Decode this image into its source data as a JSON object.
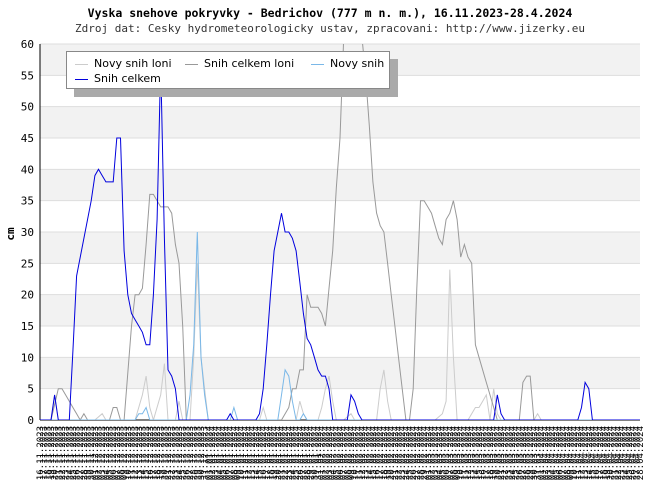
{
  "title": "Vyska snehove pokryvky - Bedrichov (777 m n. m.), 16.11.2023-28.4.2024",
  "subtitle": "Zdroj dat: Cesky hydrometeorologicky ustav, zpracovani: http://www.jizerky.eu",
  "corner_label": "jizerky.eu",
  "chart_data": {
    "type": "line",
    "ylabel": "cm",
    "ylim": [
      0,
      60
    ],
    "yticks": [
      0,
      5,
      10,
      15,
      20,
      25,
      30,
      35,
      40,
      45,
      50,
      55,
      60
    ],
    "xlim": [
      0,
      164
    ],
    "grid": true,
    "legend_position": "top-left",
    "x_start_date": "2023-11-16",
    "x_end_date": "2024-04-28",
    "series": [
      {
        "name": "Novy snih loni",
        "color": "#cccccc",
        "points": [
          [
            0,
            0
          ],
          [
            3,
            0
          ],
          [
            4,
            4
          ],
          [
            5,
            0
          ],
          [
            15,
            0
          ],
          [
            17,
            1
          ],
          [
            18,
            0
          ],
          [
            26,
            0
          ],
          [
            28,
            4
          ],
          [
            29,
            7
          ],
          [
            30,
            2
          ],
          [
            31,
            0
          ],
          [
            33,
            4
          ],
          [
            34,
            9
          ],
          [
            35,
            0
          ],
          [
            37,
            0
          ],
          [
            38,
            3
          ],
          [
            39,
            0
          ],
          [
            41,
            0
          ],
          [
            42,
            10
          ],
          [
            43,
            25
          ],
          [
            44,
            10
          ],
          [
            45,
            5
          ],
          [
            46,
            0
          ],
          [
            60,
            0
          ],
          [
            61,
            2
          ],
          [
            62,
            0
          ],
          [
            70,
            0
          ],
          [
            71,
            3
          ],
          [
            72,
            1
          ],
          [
            73,
            0
          ],
          [
            76,
            0
          ],
          [
            77,
            2
          ],
          [
            78,
            5
          ],
          [
            79,
            7
          ],
          [
            80,
            3
          ],
          [
            81,
            0
          ],
          [
            83,
            0
          ],
          [
            85,
            1
          ],
          [
            86,
            0
          ],
          [
            92,
            0
          ],
          [
            93,
            5
          ],
          [
            94,
            8
          ],
          [
            95,
            3
          ],
          [
            96,
            0
          ],
          [
            108,
            0
          ],
          [
            110,
            1
          ],
          [
            111,
            3
          ],
          [
            112,
            24
          ],
          [
            113,
            10
          ],
          [
            114,
            0
          ],
          [
            117,
            0
          ],
          [
            118,
            1
          ],
          [
            119,
            2
          ],
          [
            120,
            2
          ],
          [
            121,
            3
          ],
          [
            122,
            4
          ],
          [
            123,
            0
          ],
          [
            124,
            5
          ],
          [
            125,
            1
          ],
          [
            126,
            0
          ],
          [
            135,
            0
          ],
          [
            136,
            1
          ],
          [
            137,
            0
          ],
          [
            164,
            0
          ]
        ]
      },
      {
        "name": "Snih celkem loni",
        "color": "#999999",
        "points": [
          [
            0,
            0
          ],
          [
            3,
            0
          ],
          [
            5,
            5
          ],
          [
            6,
            5
          ],
          [
            7,
            4
          ],
          [
            8,
            3
          ],
          [
            9,
            2
          ],
          [
            10,
            1
          ],
          [
            11,
            0
          ],
          [
            12,
            1
          ],
          [
            13,
            0
          ],
          [
            19,
            0
          ],
          [
            20,
            2
          ],
          [
            21,
            2
          ],
          [
            22,
            0
          ],
          [
            23,
            0
          ],
          [
            25,
            15
          ],
          [
            26,
            20
          ],
          [
            27,
            20
          ],
          [
            28,
            21
          ],
          [
            29,
            28
          ],
          [
            30,
            36
          ],
          [
            31,
            36
          ],
          [
            32,
            35
          ],
          [
            33,
            34
          ],
          [
            34,
            34
          ],
          [
            35,
            34
          ],
          [
            36,
            33
          ],
          [
            37,
            28
          ],
          [
            38,
            25
          ],
          [
            39,
            15
          ],
          [
            40,
            0
          ],
          [
            66,
            0
          ],
          [
            68,
            2
          ],
          [
            69,
            5
          ],
          [
            70,
            5
          ],
          [
            71,
            8
          ],
          [
            72,
            8
          ],
          [
            73,
            20
          ],
          [
            74,
            18
          ],
          [
            75,
            18
          ],
          [
            76,
            18
          ],
          [
            77,
            17
          ],
          [
            78,
            15
          ],
          [
            79,
            21
          ],
          [
            80,
            27
          ],
          [
            81,
            37
          ],
          [
            82,
            45
          ],
          [
            83,
            61
          ],
          [
            88,
            61
          ],
          [
            89,
            55
          ],
          [
            90,
            47
          ],
          [
            91,
            38
          ],
          [
            92,
            33
          ],
          [
            93,
            31
          ],
          [
            94,
            30
          ],
          [
            95,
            25
          ],
          [
            96,
            20
          ],
          [
            97,
            15
          ],
          [
            98,
            10
          ],
          [
            99,
            5
          ],
          [
            100,
            0
          ],
          [
            101,
            0
          ],
          [
            102,
            5
          ],
          [
            103,
            21
          ],
          [
            104,
            35
          ],
          [
            105,
            35
          ],
          [
            106,
            34
          ],
          [
            107,
            33
          ],
          [
            108,
            31
          ],
          [
            109,
            29
          ],
          [
            110,
            28
          ],
          [
            111,
            32
          ],
          [
            112,
            33
          ],
          [
            113,
            35
          ],
          [
            114,
            32
          ],
          [
            115,
            26
          ],
          [
            116,
            28
          ],
          [
            117,
            26
          ],
          [
            118,
            25
          ],
          [
            119,
            12
          ],
          [
            120,
            10
          ],
          [
            122,
            6
          ],
          [
            124,
            2
          ],
          [
            125,
            0
          ],
          [
            131,
            0
          ],
          [
            132,
            6
          ],
          [
            133,
            7
          ],
          [
            134,
            7
          ],
          [
            135,
            0
          ],
          [
            164,
            0
          ]
        ]
      },
      {
        "name": "Novy snih",
        "color": "#7ab8e8",
        "points": [
          [
            0,
            0
          ],
          [
            26,
            0
          ],
          [
            27,
            1
          ],
          [
            28,
            1
          ],
          [
            29,
            2
          ],
          [
            30,
            0
          ],
          [
            40,
            0
          ],
          [
            41,
            4
          ],
          [
            42,
            12
          ],
          [
            43,
            30
          ],
          [
            44,
            10
          ],
          [
            45,
            4
          ],
          [
            46,
            0
          ],
          [
            52,
            0
          ],
          [
            53,
            2
          ],
          [
            54,
            0
          ],
          [
            65,
            0
          ],
          [
            66,
            4
          ],
          [
            67,
            8
          ],
          [
            68,
            7
          ],
          [
            69,
            3
          ],
          [
            70,
            0
          ],
          [
            71,
            0
          ],
          [
            72,
            1
          ],
          [
            73,
            0
          ],
          [
            164,
            0
          ]
        ]
      },
      {
        "name": "Snih celkem",
        "color": "#0000dd",
        "points": [
          [
            0,
            0
          ],
          [
            3,
            0
          ],
          [
            4,
            4
          ],
          [
            5,
            0
          ],
          [
            8,
            0
          ],
          [
            9,
            11
          ],
          [
            10,
            23
          ],
          [
            14,
            35
          ],
          [
            15,
            39
          ],
          [
            16,
            40
          ],
          [
            17,
            39
          ],
          [
            18,
            38
          ],
          [
            19,
            38
          ],
          [
            20,
            38
          ],
          [
            21,
            45
          ],
          [
            22,
            45
          ],
          [
            23,
            27
          ],
          [
            24,
            20
          ],
          [
            25,
            17
          ],
          [
            26,
            16
          ],
          [
            27,
            15
          ],
          [
            28,
            14
          ],
          [
            29,
            12
          ],
          [
            30,
            12
          ],
          [
            31,
            20
          ],
          [
            32,
            32
          ],
          [
            33,
            57
          ],
          [
            34,
            29
          ],
          [
            35,
            8
          ],
          [
            36,
            7
          ],
          [
            37,
            5
          ],
          [
            38,
            0
          ],
          [
            51,
            0
          ],
          [
            52,
            1
          ],
          [
            53,
            0
          ],
          [
            59,
            0
          ],
          [
            60,
            1
          ],
          [
            61,
            5
          ],
          [
            62,
            12
          ],
          [
            63,
            20
          ],
          [
            64,
            27
          ],
          [
            65,
            30
          ],
          [
            66,
            33
          ],
          [
            67,
            30
          ],
          [
            68,
            30
          ],
          [
            69,
            29
          ],
          [
            70,
            27
          ],
          [
            71,
            22
          ],
          [
            72,
            17
          ],
          [
            73,
            13
          ],
          [
            74,
            12
          ],
          [
            75,
            10
          ],
          [
            76,
            8
          ],
          [
            77,
            7
          ],
          [
            78,
            7
          ],
          [
            79,
            5
          ],
          [
            80,
            0
          ],
          [
            84,
            0
          ],
          [
            85,
            4
          ],
          [
            86,
            3
          ],
          [
            87,
            1
          ],
          [
            88,
            0
          ],
          [
            124,
            0
          ],
          [
            125,
            4
          ],
          [
            126,
            1
          ],
          [
            127,
            0
          ],
          [
            147,
            0
          ],
          [
            148,
            2
          ],
          [
            149,
            6
          ],
          [
            150,
            5
          ],
          [
            151,
            0
          ],
          [
            164,
            0
          ]
        ]
      }
    ]
  }
}
